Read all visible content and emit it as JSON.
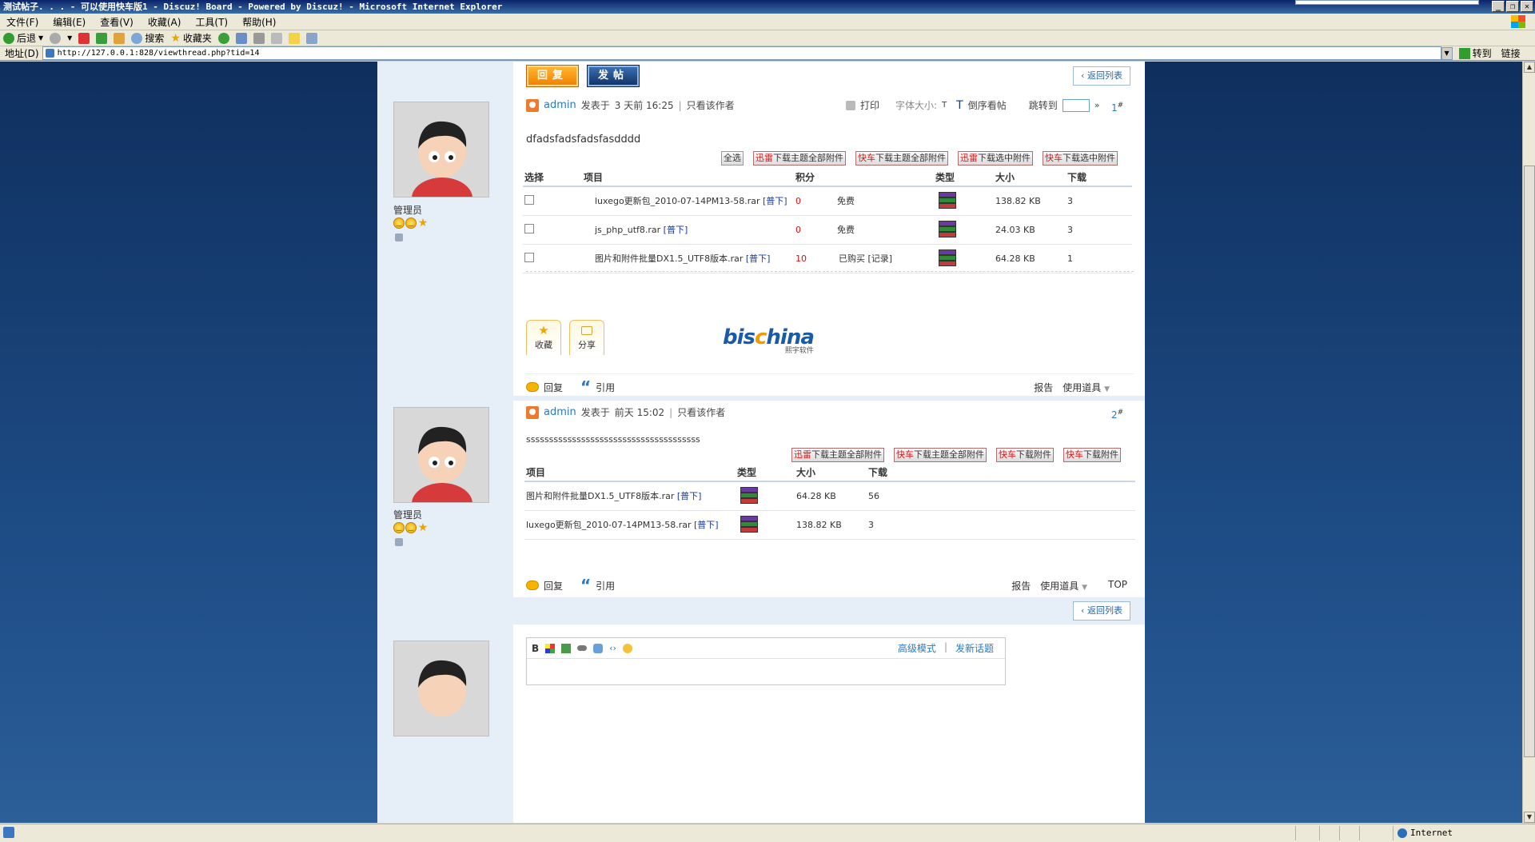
{
  "window": {
    "title": "测试帖子. . . - 可以使用快车版1 - Discuz! Board - Powered by Discuz! - Microsoft Internet Explorer"
  },
  "menu": [
    "文件(F)",
    "编辑(E)",
    "查看(V)",
    "收藏(A)",
    "工具(T)",
    "帮助(H)"
  ],
  "toolbar": {
    "back": "后退",
    "search": "搜索",
    "favorites": "收藏夹"
  },
  "address": {
    "label": "地址(D)",
    "url": "http://127.0.0.1:828/viewthread.php?tid=14",
    "go": "转到",
    "links": "链接"
  },
  "status": {
    "zone": "Internet"
  },
  "thread": {
    "reply_btn": "回复",
    "post_btn": "发帖",
    "back_to_list": "返回列表"
  },
  "posts": [
    {
      "role": "管理员",
      "author": "admin",
      "posted_label": "发表于",
      "time": "3 天前 16:25",
      "only_author": "只看该作者",
      "print": "打印",
      "font_size": "字体大小:",
      "font_t": "T",
      "reverse": "倒序看帖",
      "jump": "跳转到",
      "floor": "1",
      "content": "dfadsfadsfadsfasdddd",
      "select_all": "全选",
      "dl_buttons": [
        {
          "red": "迅雷",
          "rest": "下载主题全部附件"
        },
        {
          "red": "快车",
          "rest": "下载主题全部附件"
        },
        {
          "red": "迅雷",
          "rest": "下载选中附件"
        },
        {
          "red": "快车",
          "rest": "下载选中附件"
        }
      ],
      "columns": [
        "选择",
        "项目",
        "积分",
        "类型",
        "大小",
        "下载"
      ],
      "rows": [
        {
          "name": "luxego更新包_2010-07-14PM13-58.rar",
          "tag": "[普下]",
          "points": "0",
          "status": "免费",
          "size": "138.82 KB",
          "downloads": "3"
        },
        {
          "name": "js_php_utf8.rar",
          "tag": "[普下]",
          "points": "0",
          "status": "免费",
          "size": "24.03 KB",
          "downloads": "3"
        },
        {
          "name": "图片和附件批量DX1.5_UTF8版本.rar",
          "tag": "[普下]",
          "points": "10",
          "status": "已购买 [记录]",
          "size": "64.28 KB",
          "downloads": "1"
        }
      ],
      "fav": "收藏",
      "share": "分享",
      "logo": {
        "a": "bis",
        "b": "c",
        "c": "hina",
        "sub": "熙宇软件"
      },
      "reply": "回复",
      "quote": "引用",
      "report": "报告",
      "tools": "使用道具"
    },
    {
      "role": "管理员",
      "author": "admin",
      "posted_label": "发表于",
      "time": "前天 15:02",
      "only_author": "只看该作者",
      "floor": "2",
      "content": "ssssssssssssssssssssssssssssssssssssss",
      "dl_buttons": [
        {
          "red": "迅雷",
          "rest": "下载主题全部附件"
        },
        {
          "red": "快车",
          "rest": "下载主题全部附件"
        },
        {
          "red": "快车",
          "rest": "下载附件"
        },
        {
          "red": "快车",
          "rest": "下载附件"
        }
      ],
      "columns": [
        "项目",
        "类型",
        "大小",
        "下载"
      ],
      "rows": [
        {
          "name": "图片和附件批量DX1.5_UTF8版本.rar",
          "tag": "[普下]",
          "size": "64.28 KB",
          "downloads": "56"
        },
        {
          "name": "luxego更新包_2010-07-14PM13-58.rar",
          "tag": "[普下]",
          "size": "138.82 KB",
          "downloads": "3"
        }
      ],
      "reply": "回复",
      "quote": "引用",
      "report": "报告",
      "tools": "使用道具",
      "top": "TOP"
    }
  ],
  "editor": {
    "bold": "B",
    "advanced": "高级模式",
    "sep": "|",
    "new_topic": "发新话题"
  }
}
